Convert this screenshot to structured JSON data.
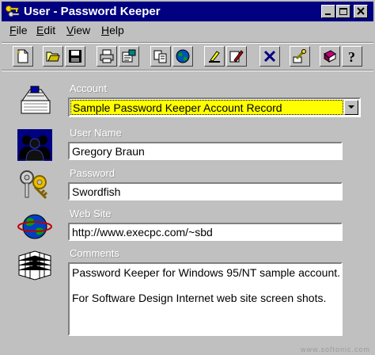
{
  "window": {
    "title": "User - Password Keeper"
  },
  "menu": {
    "items": [
      {
        "label": "File",
        "accel": "F",
        "rest": "ile"
      },
      {
        "label": "Edit",
        "accel": "E",
        "rest": "dit"
      },
      {
        "label": "View",
        "accel": "V",
        "rest": "iew"
      },
      {
        "label": "Help",
        "accel": "H",
        "rest": "elp"
      }
    ]
  },
  "toolbar": {
    "buttons": [
      "new-icon",
      "open-folder-icon",
      "save-disk-icon",
      "print-icon",
      "properties-icon",
      "copy-icon",
      "globe-icon",
      "edit-record-icon",
      "edit-pencil-icon",
      "delete-x-icon",
      "key-icon",
      "book-icon",
      "help-icon"
    ]
  },
  "form": {
    "account_label": "Account",
    "account_value": "Sample Password Keeper Account Record",
    "username_label": "User Name",
    "username_value": "Gregory Braun",
    "password_label": "Password",
    "password_value": "Swordfish",
    "website_label": "Web Site",
    "website_value": "http://www.execpc.com/~sbd",
    "comments_label": "Comments",
    "comments_line1": "Password Keeper for Windows 95/NT sample account.",
    "comments_line2": "For Software Design Internet web site screen shots."
  },
  "watermark": "www.softonic.com",
  "colors": {
    "titlebar": "#000080",
    "selection": "#ffff00",
    "face": "#c0c0c0"
  }
}
